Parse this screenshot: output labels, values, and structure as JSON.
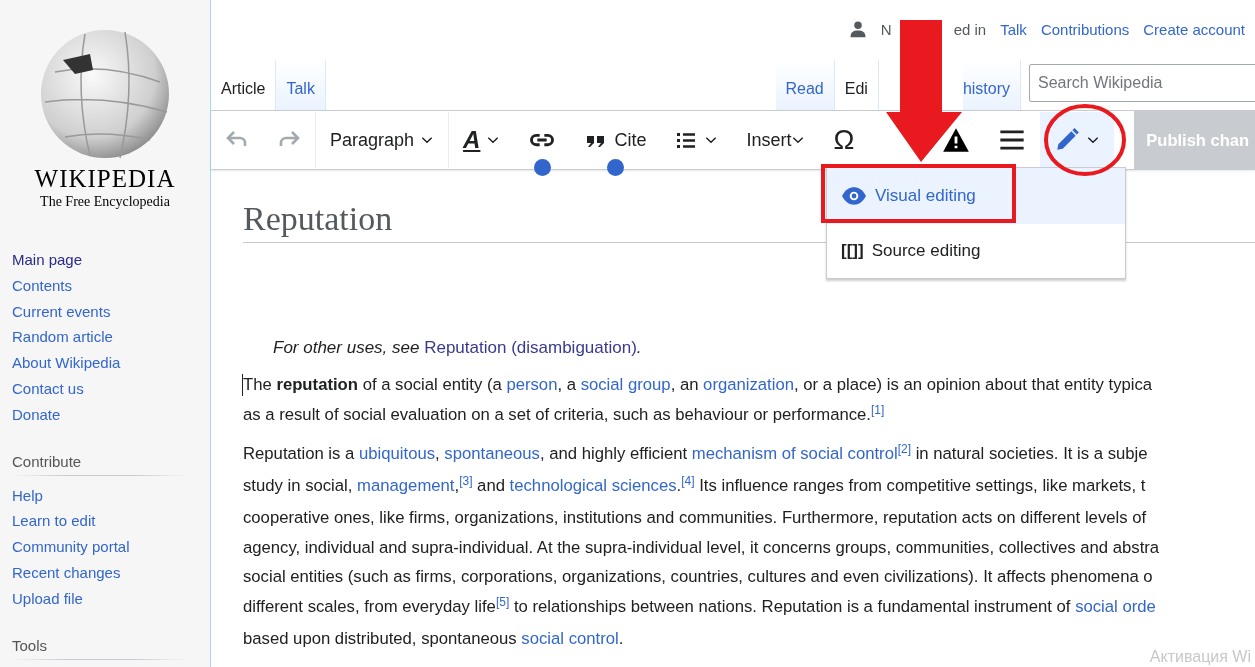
{
  "sidebar": {
    "logo": {
      "wordmark": "WIKIPEDIA",
      "tagline": "The Free Encyclopedia"
    },
    "navigation": [
      {
        "label": "Main page",
        "visited": true
      },
      {
        "label": "Contents",
        "visited": false
      },
      {
        "label": "Current events",
        "visited": false
      },
      {
        "label": "Random article",
        "visited": false
      },
      {
        "label": "About Wikipedia",
        "visited": false
      },
      {
        "label": "Contact us",
        "visited": false
      },
      {
        "label": "Donate",
        "visited": false
      }
    ],
    "sections": [
      {
        "heading": "Contribute",
        "items": [
          "Help",
          "Learn to edit",
          "Community portal",
          "Recent changes",
          "Upload file"
        ]
      },
      {
        "heading": "Tools"
      }
    ]
  },
  "user_bar": {
    "status": [
      "N",
      "ed in"
    ],
    "links": [
      "Talk",
      "Contributions",
      "Create account"
    ]
  },
  "namespace_tabs": [
    {
      "label": "Article",
      "selected": true
    },
    {
      "label": "Talk",
      "selected": false
    }
  ],
  "view_tabs": [
    {
      "label": "Read",
      "selected": false
    },
    {
      "label": "Edi",
      "selected": true
    },
    {
      "label": "history",
      "selected": false
    }
  ],
  "search": {
    "placeholder": "Search Wikipedia"
  },
  "toolbar": {
    "items": [
      {
        "kind": "undo"
      },
      {
        "kind": "redo"
      },
      {
        "kind": "dropdown",
        "label": "Paragraph"
      },
      {
        "kind": "style",
        "label": "A"
      },
      {
        "kind": "link",
        "dot": true
      },
      {
        "kind": "cite",
        "label": "Cite",
        "dot": true
      },
      {
        "kind": "list"
      },
      {
        "kind": "insert",
        "label": "Insert"
      },
      {
        "kind": "special",
        "label": "Ω"
      },
      {
        "kind": "warning"
      },
      {
        "kind": "menu"
      },
      {
        "kind": "editmode"
      }
    ],
    "publish": "Publish chan"
  },
  "edit_menu": [
    {
      "label": "Visual editing",
      "kind": "visual",
      "selected": true
    },
    {
      "label": "Source editing",
      "kind": "source",
      "glyph": "[[]]",
      "selected": false
    }
  ],
  "article": {
    "title": "Reputation",
    "hatnote": {
      "text": "For other uses, see ",
      "link": "Reputation (disambiguation)",
      "end": "."
    },
    "paragraphs": [
      [
        [
          {
            "kind": "text",
            "text": "The "
          },
          {
            "kind": "bold",
            "text": "reputation"
          },
          {
            "kind": "text",
            "text": " of a social entity (a "
          },
          {
            "kind": "link",
            "text": "person"
          },
          {
            "kind": "text",
            "text": ", a "
          },
          {
            "kind": "link",
            "text": "social group"
          },
          {
            "kind": "text",
            "text": ", an "
          },
          {
            "kind": "link",
            "text": "organization"
          },
          {
            "kind": "text",
            "text": ", or a place) is an opinion about that entity typica"
          }
        ],
        [
          {
            "kind": "text",
            "text": "as a result of social evaluation on a set of criteria, such as behaviour or performance."
          },
          {
            "kind": "ref",
            "text": "[1]"
          }
        ]
      ],
      [
        [
          {
            "kind": "text",
            "text": "Reputation is a "
          },
          {
            "kind": "link",
            "text": "ubiquitous"
          },
          {
            "kind": "text",
            "text": ", "
          },
          {
            "kind": "link",
            "text": "spontaneous"
          },
          {
            "kind": "text",
            "text": ", and highly efficient "
          },
          {
            "kind": "link",
            "text": "mechanism of social control"
          },
          {
            "kind": "ref",
            "text": "[2]"
          },
          {
            "kind": "text",
            "text": " in natural societies. It is a subje"
          }
        ],
        [
          {
            "kind": "text",
            "text": "study in social, "
          },
          {
            "kind": "link",
            "text": "management"
          },
          {
            "kind": "text",
            "text": ","
          },
          {
            "kind": "ref",
            "text": "[3]"
          },
          {
            "kind": "text",
            "text": " and "
          },
          {
            "kind": "link",
            "text": "technological sciences"
          },
          {
            "kind": "text",
            "text": "."
          },
          {
            "kind": "ref",
            "text": "[4]"
          },
          {
            "kind": "text",
            "text": " Its influence ranges from competitive settings, like markets, t"
          }
        ],
        [
          {
            "kind": "text",
            "text": "cooperative ones, like firms, organizations, institutions and communities. Furthermore, reputation acts on different levels of"
          }
        ],
        [
          {
            "kind": "text",
            "text": "agency, individual and supra-individual. At the supra-individual level, it concerns groups, communities, collectives and abstra"
          }
        ],
        [
          {
            "kind": "text",
            "text": "social entities (such as firms, corporations, organizations, countries, cultures and even civilizations). It affects phenomena o"
          }
        ],
        [
          {
            "kind": "text",
            "text": "different scales, from everyday life"
          },
          {
            "kind": "ref",
            "text": "[5]"
          },
          {
            "kind": "text",
            "text": " to relationships between nations. Reputation is a fundamental instrument of "
          },
          {
            "kind": "link",
            "text": "social orde"
          }
        ],
        [
          {
            "kind": "text",
            "text": "based upon distributed, spontaneous "
          },
          {
            "kind": "link",
            "text": "social control"
          },
          {
            "kind": "text",
            "text": "."
          }
        ]
      ]
    ]
  },
  "os_notice": "Активация Wi"
}
